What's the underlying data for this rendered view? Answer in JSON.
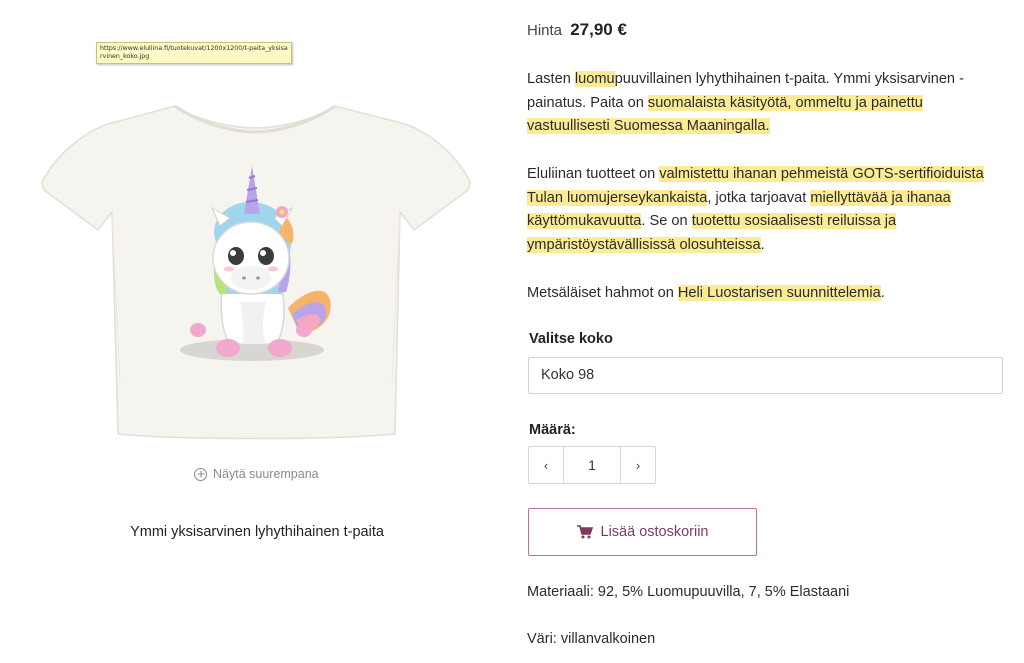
{
  "product_image": {
    "tooltip": "https://www.eluliina.fi/tuotekuvat/1200x1200/t-paita_yksisarvinen_koko.jpg",
    "zoom_label": "Näytä suurempana",
    "caption": "Ymmi yksisarvinen lyhythihainen t-paita"
  },
  "price": {
    "label": "Hinta",
    "value": "27,90 €"
  },
  "description": {
    "p1": {
      "s1": "Lasten ",
      "h1": "luomu",
      "s2": "puuvillainen lyhythihainen t-paita. Ymmi yksisarvinen - painatus. Paita on ",
      "h2": "suomalaista käsityötä, ommeltu ja painettu vastuullisesti Suomessa Maaningalla.",
      "s3": ""
    },
    "p2": {
      "s1": "Eluliinan tuotteet on ",
      "h1": "valmistettu ihanan pehmeistä GOTS-sertifioiduista Tulan luomujerseykankaista",
      "s2": ", jotka tarjoavat ",
      "h2": "miellyttävää ja ihanaa käyttömukavuutta",
      "s3": ". Se on ",
      "h3": "tuotettu sosiaalisesti reiluissa ja ympäristöystävällisissä olosuhteissa",
      "s4": "."
    },
    "p3": {
      "s1": "Metsäläiset hahmot on ",
      "h1": "Heli Luostarisen suunnittelemia",
      "s2": "."
    }
  },
  "size": {
    "label": "Valitse koko",
    "selected": "Koko 98"
  },
  "quantity": {
    "label": "Määrä:",
    "value": "1",
    "minus_glyph": "‹",
    "plus_glyph": "›"
  },
  "cart": {
    "label": "Lisää ostoskoriin",
    "icon": "shopping-cart-icon",
    "accent_color": "#b8739a"
  },
  "specs": {
    "material": "Materiaali: 92, 5% Luomupuuvilla, 7, 5% Elastaani",
    "color": "Väri: villanvalkoinen"
  },
  "highlight_color": "#fbeb94"
}
